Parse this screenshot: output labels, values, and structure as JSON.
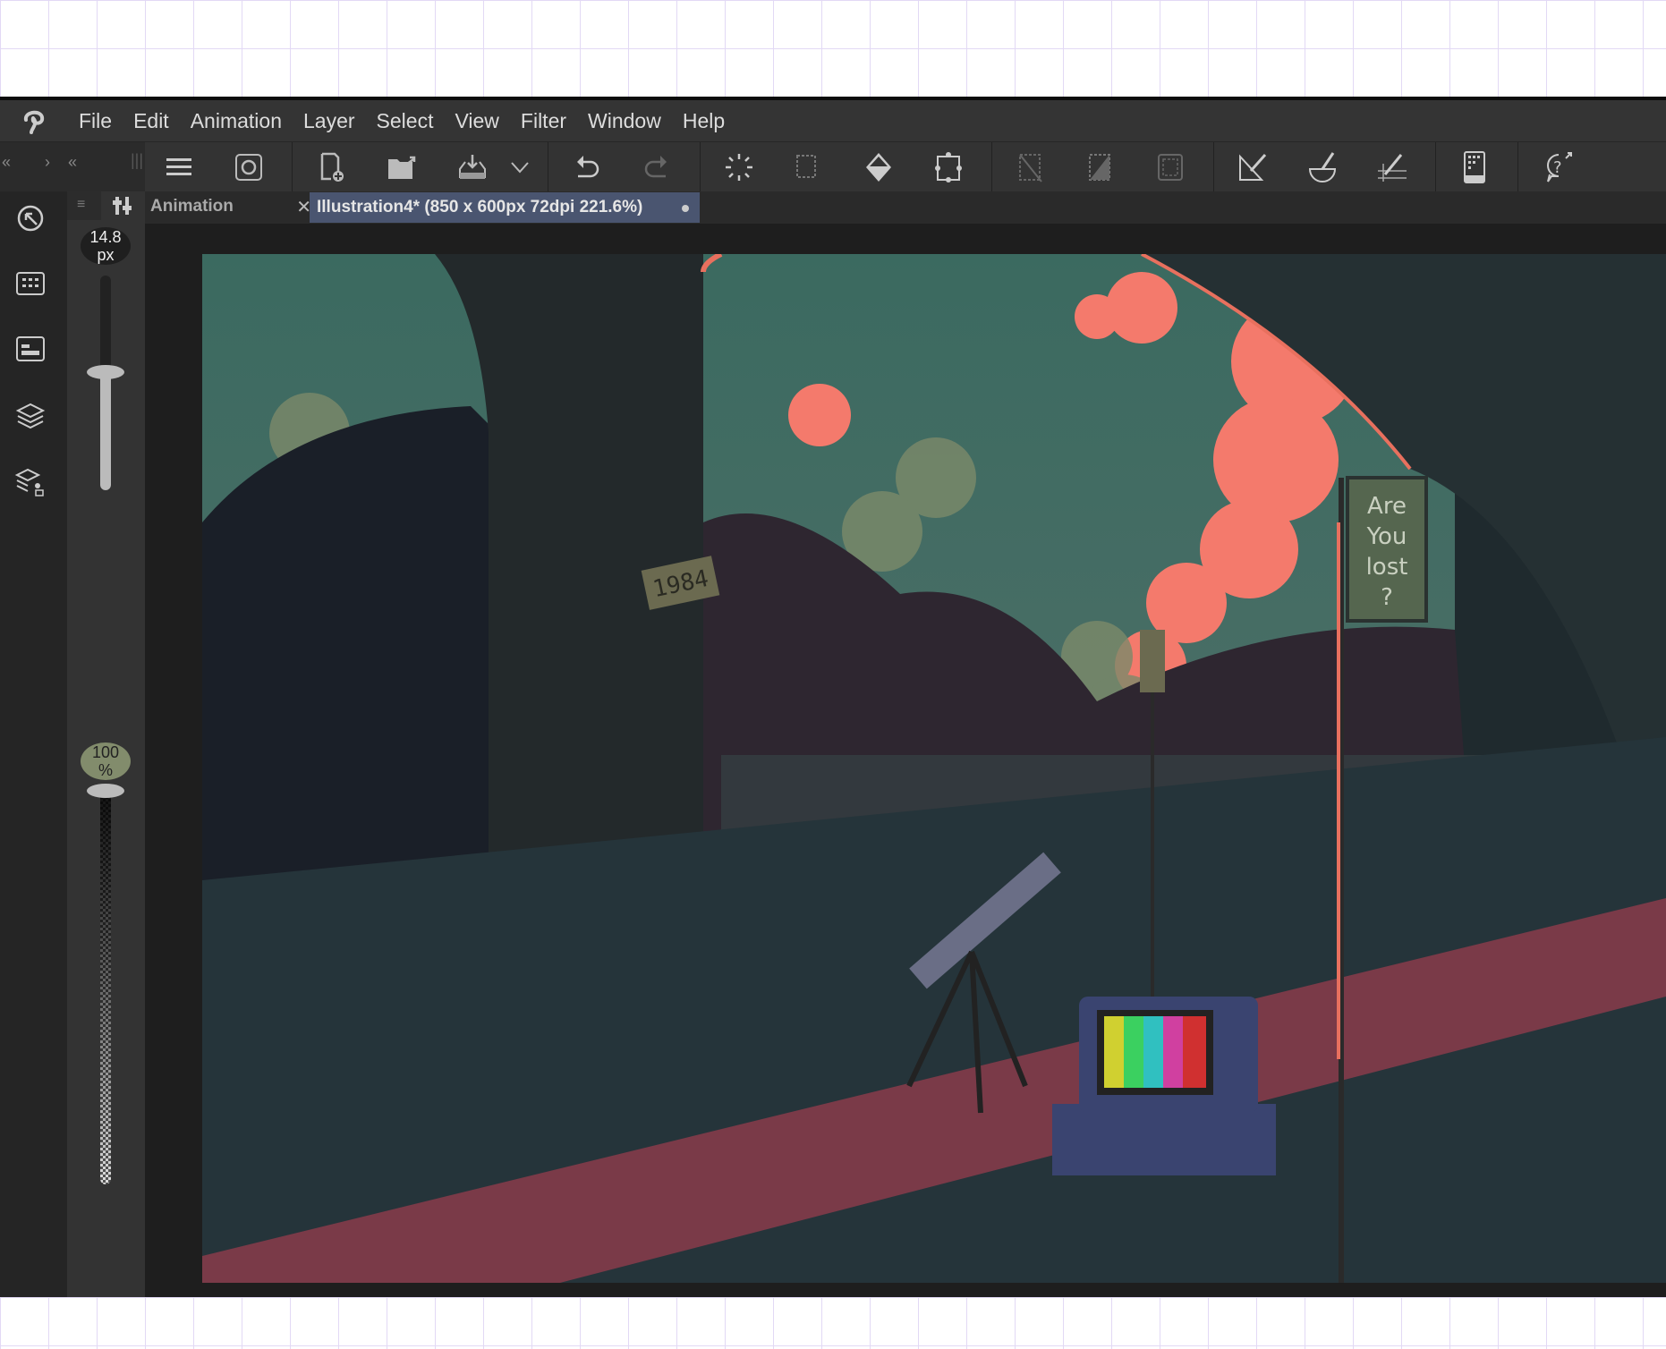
{
  "menubar": {
    "items": [
      "File",
      "Edit",
      "Animation",
      "Layer",
      "Select",
      "View",
      "Filter",
      "Window",
      "Help"
    ]
  },
  "toolbar": {
    "tools": [
      "menu-icon",
      "clip-studio-icon",
      "new-file-icon",
      "open-file-icon",
      "save-icon",
      "save-dropdown-icon",
      "undo-icon",
      "redo-icon",
      "loading-icon",
      "select-more-icon",
      "fill-icon",
      "transform-icon",
      "clear-selection-icon",
      "invert-selection-icon",
      "select-area-icon",
      "ruler-icon",
      "brush-ruler-icon",
      "grid-ruler-icon",
      "smartphone-icon",
      "help-icon"
    ]
  },
  "tabs": [
    {
      "label": "Animation",
      "active": false
    },
    {
      "label": "Illustration4* (850 x 600px 72dpi 221.6%)",
      "active": true
    }
  ],
  "sidebar": {
    "brush_size": "14.8",
    "brush_size_unit": "px",
    "opacity": "100",
    "opacity_unit": "%",
    "brush_size_level": 0.55,
    "opacity_level": 1.0
  },
  "colors": {
    "menubar": "#343434",
    "tab_active": "#4a5570",
    "sky": "#3d6a62",
    "cloud": "#f47a6c",
    "path": "#7a3a48",
    "opacity_badge": "#828c6c"
  },
  "artwork": {
    "plaque": "1984",
    "sign": [
      "Are",
      "You",
      "lost",
      "?"
    ]
  }
}
